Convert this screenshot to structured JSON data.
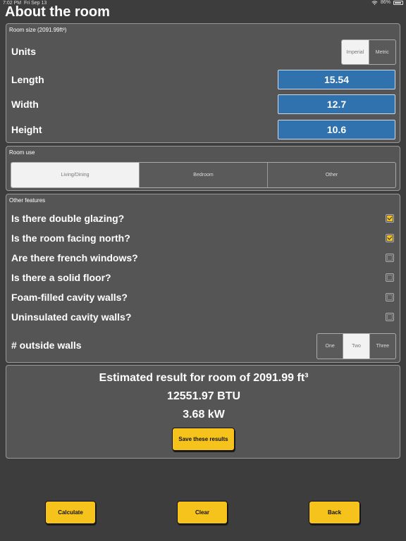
{
  "status_bar": {
    "time": "7:02 PM",
    "date": "Fri Sep 13",
    "battery": "86%"
  },
  "page_title": "About the room",
  "room_size": {
    "header": "Room size  (2091.99ft³)",
    "units_label": "Units",
    "units_options": [
      "Imperial",
      "Metric"
    ],
    "units_selected": "Imperial",
    "length_label": "Length",
    "length_value": "15.54",
    "width_label": "Width",
    "width_value": "12.7",
    "height_label": "Height",
    "height_value": "10.6"
  },
  "room_use": {
    "header": "Room use",
    "options": [
      "Living/Dining",
      "Bedroom",
      "Other"
    ],
    "selected": "Living/Dining"
  },
  "other_features": {
    "header": "Other features",
    "items": [
      {
        "label": "Is there double glazing?",
        "checked": true
      },
      {
        "label": "Is the room facing north?",
        "checked": true
      },
      {
        "label": "Are there french windows?",
        "checked": false
      },
      {
        "label": "Is there a solid floor?",
        "checked": false
      },
      {
        "label": "Foam-filled cavity walls?",
        "checked": false
      },
      {
        "label": "Uninsulated cavity walls?",
        "checked": false
      }
    ],
    "walls_label": "# outside walls",
    "walls_options": [
      "One",
      "Two",
      "Three"
    ],
    "walls_selected": "Two"
  },
  "result": {
    "title": "Estimated result for room of 2091.99 ft³",
    "btu": "12551.97 BTU",
    "kw": "3.68 kW",
    "save_label": "Save these results"
  },
  "actions": {
    "calculate": "Calculate",
    "clear": "Clear",
    "back": "Back"
  },
  "colors": {
    "background": "#3d3d3d",
    "panel": "#555555",
    "field": "#2f72ad",
    "accent": "#f6c21c"
  }
}
